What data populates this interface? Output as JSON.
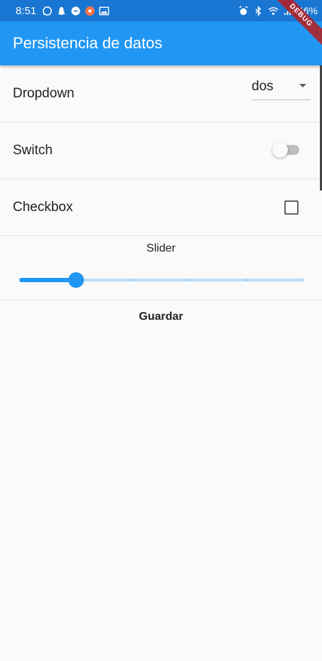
{
  "status_bar": {
    "time": "8:51",
    "battery": "46%",
    "left_icons": [
      "whatsapp-icon",
      "snapchat-icon",
      "messenger-icon",
      "app-icon",
      "gallery-icon"
    ],
    "right_icons": [
      "alarm-icon",
      "bluetooth-icon",
      "wifi-icon",
      "signal-icon"
    ]
  },
  "debug_banner": "DEBUG",
  "app_bar": {
    "title": "Persistencia de datos"
  },
  "rows": {
    "dropdown": {
      "label": "Dropdown",
      "value": "dos"
    },
    "switch": {
      "label": "Switch",
      "on": false
    },
    "checkbox": {
      "label": "Checkbox",
      "checked": false
    }
  },
  "slider": {
    "label": "Slider",
    "value": 1,
    "min": 0,
    "max": 5,
    "divisions": 5
  },
  "save_button": {
    "label": "Guardar"
  },
  "colors": {
    "primary": "#2196f3",
    "status_bar": "#1976d2",
    "background": "#fafafa",
    "slider_inactive": "#bbdefb",
    "debug_banner": "#b71c1c"
  }
}
